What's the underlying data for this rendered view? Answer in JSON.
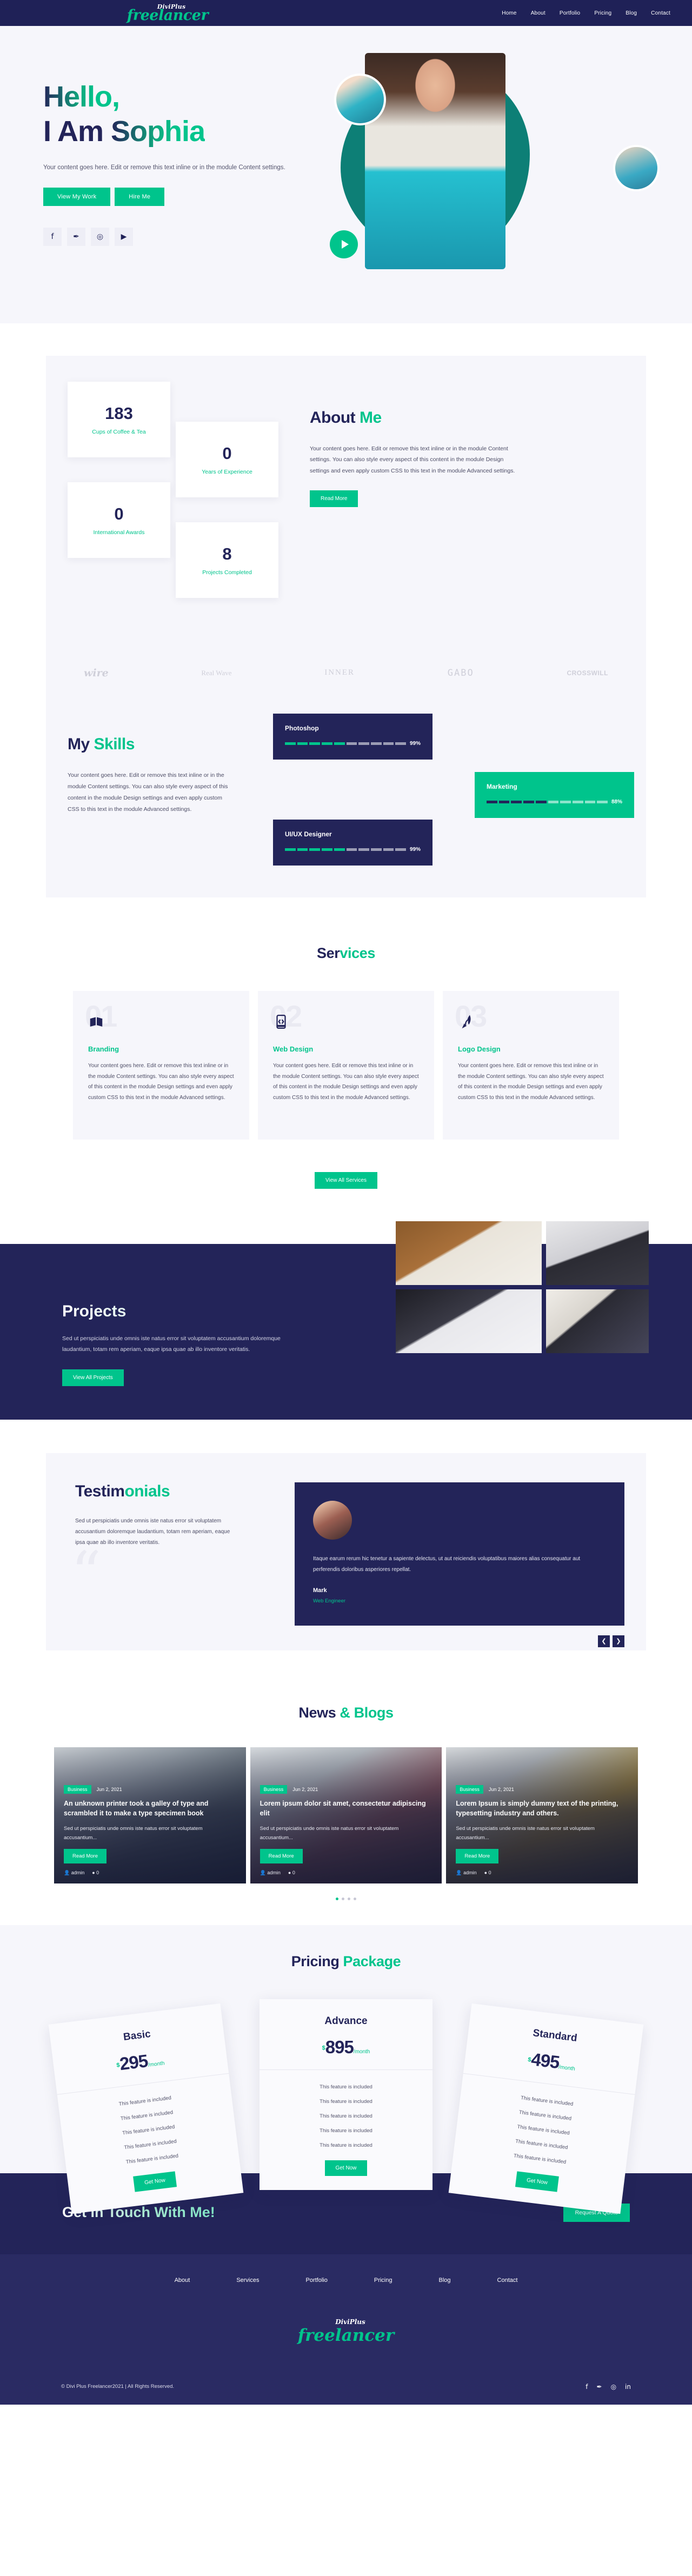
{
  "brand": {
    "sub": "DiviPlus",
    "main": "freelancer",
    "accent": "#00c48c",
    "navy": "#232459"
  },
  "nav": {
    "items": [
      "Home",
      "About",
      "Portfolio",
      "Pricing",
      "Blog",
      "Contact"
    ]
  },
  "hero": {
    "line1": "Hello,",
    "line2_pre": "I Am ",
    "line2_name": "Sophia",
    "paragraph": "Your content goes here. Edit or remove this text inline or in the module Content settings.",
    "btn_primary": "View My Work",
    "btn_secondary": "Hire Me",
    "socials": [
      "facebook-icon",
      "twitter-icon",
      "instagram-icon",
      "youtube-icon"
    ],
    "social_glyphs": [
      "f",
      "✒",
      "◎",
      "▶"
    ]
  },
  "stats": [
    {
      "value": "183",
      "label": "Cups of Coffee & Tea"
    },
    {
      "value": "0",
      "label": "Years of Experience"
    },
    {
      "value": "0",
      "label": "International Awards"
    },
    {
      "value": "8",
      "label": "Projects Completed"
    }
  ],
  "about": {
    "title_dark": "About ",
    "title_green": "Me",
    "paragraph": "Your content goes here. Edit or remove this text inline or in the module Content settings. You can also style every aspect of this content in the module Design settings and even apply custom CSS to this text in the module Advanced settings.",
    "button": "Read More"
  },
  "brands": [
    {
      "name": "wire",
      "style": "script"
    },
    {
      "name": "Real Wave",
      "style": "serif"
    },
    {
      "name": "INNER",
      "style": "serif-caps"
    },
    {
      "name": "GABO",
      "style": "mono"
    },
    {
      "name": "CROSSWILL",
      "style": "bold"
    }
  ],
  "skills": {
    "title_dark": "My ",
    "title_green": "Skills",
    "paragraph": "Your content goes here. Edit or remove this text inline or in the module Content settings. You can also style every aspect of this content in the module Design settings and even apply custom CSS to this text in the module Advanced settings.",
    "items": [
      {
        "name": "Photoshop",
        "percent": "99%",
        "value": 99,
        "theme": "navy"
      },
      {
        "name": "Marketing",
        "percent": "88%",
        "value": 88,
        "theme": "teal"
      },
      {
        "name": "UI/UX Designer",
        "percent": "99%",
        "value": 99,
        "theme": "navy"
      }
    ]
  },
  "services": {
    "title_dark": "Ser",
    "title_green": "vices",
    "items": [
      {
        "num": "01",
        "icon": "book-icon",
        "title": "Branding",
        "text": "Your content goes here. Edit or remove this text inline or in the module Content settings. You can also style every aspect of this content in the module Design settings and even apply custom CSS to this text in the module Advanced settings."
      },
      {
        "num": "02",
        "icon": "code-phone-icon",
        "title": "Web Design",
        "text": "Your content goes here. Edit or remove this text inline or in the module Content settings. You can also style every aspect of this content in the module Design settings and even apply custom CSS to this text in the module Advanced settings."
      },
      {
        "num": "03",
        "icon": "pen-nib-icon",
        "title": "Logo Design",
        "text": "Your content goes here. Edit or remove this text inline or in the module Content settings. You can also style every aspect of this content in the module Design settings and even apply custom CSS to this text in the module Advanced settings."
      }
    ],
    "button": "View All Services"
  },
  "projects": {
    "title": "Projects",
    "paragraph": "Sed ut perspiciatis unde omnis iste natus error sit voluptatem accusantium doloremque laudantium, totam rem aperiam, eaque ipsa quae ab illo inventore veritatis.",
    "button": "View All Projects"
  },
  "testimonials": {
    "title_dark": "Testim",
    "title_green": "onials",
    "paragraph": "Sed ut perspiciatis unde omnis iste natus error sit voluptatem accusantium doloremque laudantium, totam rem aperiam, eaque ipsa quae ab illo inventore veritatis.",
    "quote": "Itaque earum rerum hic tenetur a sapiente delectus, ut aut reiciendis voluptatibus maiores alias consequatur aut perferendis doloribus asperiores repellat.",
    "author": "Mark",
    "role": "Web Engineer",
    "prev": "❮",
    "next": "❯"
  },
  "blog": {
    "title_dark": "News ",
    "title_green": "& Blogs",
    "posts": [
      {
        "category": "Business",
        "date": "Jun 2, 2021",
        "title": "An unknown printer took a galley of type and scrambled it to make a type specimen book",
        "excerpt": "Sed ut perspiciatis unde omnis iste natus error sit voluptatem accusantium...",
        "button": "Read More",
        "author": "admin",
        "comments": "0"
      },
      {
        "category": "Business",
        "date": "Jun 2, 2021",
        "title": "Lorem ipsum dolor sit amet, consectetur adipiscing elit",
        "excerpt": "Sed ut perspiciatis unde omnis iste natus error sit voluptatem accusantium...",
        "button": "Read More",
        "author": "admin",
        "comments": "0"
      },
      {
        "category": "Business",
        "date": "Jun 2, 2021",
        "title": "Lorem Ipsum is simply dummy text of the printing, typesetting industry and others.",
        "excerpt": "Sed ut perspiciatis unde omnis iste natus error sit voluptatem accusantium...",
        "button": "Read More",
        "author": "admin",
        "comments": "0"
      }
    ]
  },
  "pricing": {
    "title_dark": "Pricing ",
    "title_green": "Package",
    "plans": [
      {
        "name": "Basic",
        "currency": "$",
        "amount": "295",
        "period": "/month",
        "features": [
          "This feature is included",
          "This feature is included",
          "This feature is included",
          "This feature is included",
          "This feature is included"
        ],
        "button": "Get Now"
      },
      {
        "name": "Advance",
        "currency": "$",
        "amount": "895",
        "period": "/month",
        "features": [
          "This feature is included",
          "This feature is included",
          "This feature is included",
          "This feature is included",
          "This feature is included"
        ],
        "button": "Get Now"
      },
      {
        "name": "Standard",
        "currency": "$",
        "amount": "495",
        "period": "/month",
        "features": [
          "This feature is included",
          "This feature is included",
          "This feature is included",
          "This feature is included",
          "This feature is included"
        ],
        "button": "Get Now"
      }
    ]
  },
  "cta": {
    "title": "Get In Touch With Me!",
    "button": "Request A Quote"
  },
  "footer": {
    "nav": [
      "About",
      "Services",
      "Portfolio",
      "Pricing",
      "Blog",
      "Contact"
    ],
    "logo_sub": "DiviPlus",
    "logo_main": "freelancer",
    "copyright": "© Divi Plus Freelancer2021 | All Rights Reserved.",
    "socials": [
      "facebook-icon",
      "twitter-icon",
      "instagram-icon",
      "linkedin-icon"
    ],
    "social_glyphs": [
      "f",
      "✒",
      "◎",
      "in"
    ]
  }
}
